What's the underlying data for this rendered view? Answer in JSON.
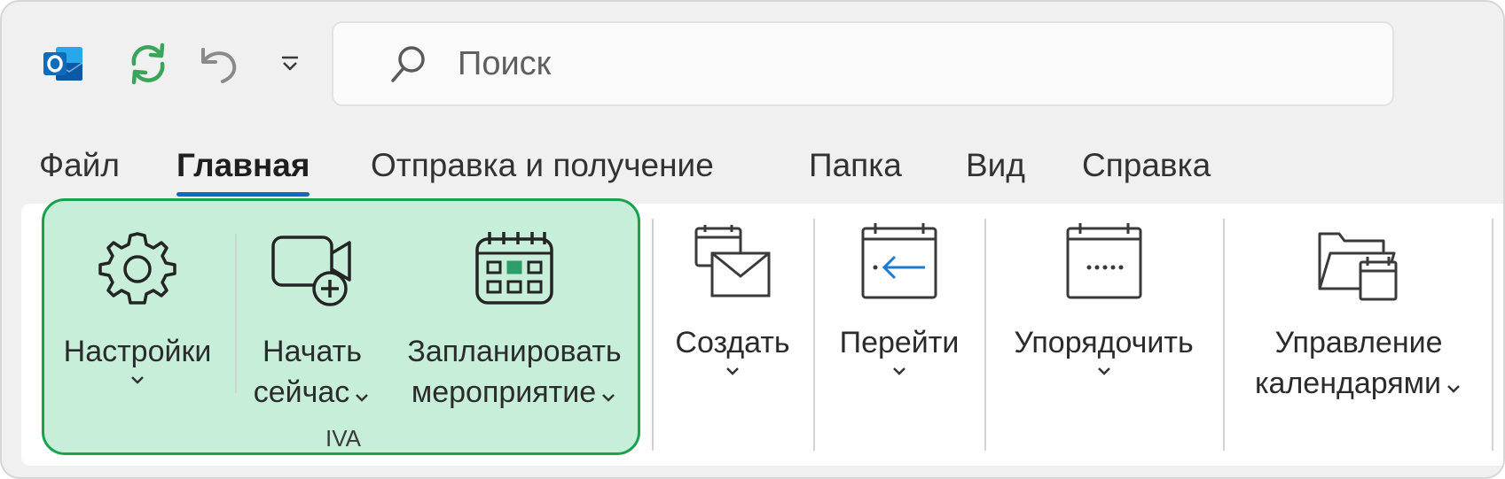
{
  "search": {
    "placeholder": "Поиск"
  },
  "tabs": [
    {
      "label": "Файл",
      "active": false
    },
    {
      "label": "Главная",
      "active": true
    },
    {
      "label": "Отправка и получение",
      "active": false
    },
    {
      "label": "Папка",
      "active": false
    },
    {
      "label": "Вид",
      "active": false
    },
    {
      "label": "Справка",
      "active": false
    }
  ],
  "ribbon": {
    "iva_group": {
      "label": "IVA",
      "settings": {
        "label": "Настройки"
      },
      "start_now": {
        "line1": "Начать",
        "line2": "сейчас"
      },
      "schedule": {
        "line1": "Запланировать",
        "line2": "мероприятие"
      }
    },
    "create": {
      "label": "Создать"
    },
    "goto": {
      "label": "Перейти"
    },
    "arrange": {
      "label": "Упорядочить"
    },
    "manage": {
      "line1": "Управление",
      "line2": "календарями"
    }
  },
  "colors": {
    "accent": "#0f6cbd",
    "highlight_fill": "#c6eed9",
    "highlight_border": "#19a14f",
    "sync_green": "#3aa55a"
  }
}
